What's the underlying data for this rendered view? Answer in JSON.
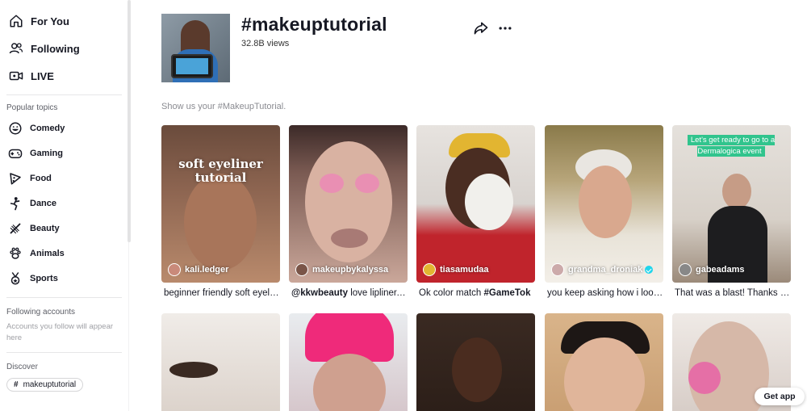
{
  "sidebar": {
    "nav": [
      {
        "label": "For You",
        "icon": "home-icon"
      },
      {
        "label": "Following",
        "icon": "following-icon"
      },
      {
        "label": "LIVE",
        "icon": "live-icon"
      }
    ],
    "popular_title": "Popular topics",
    "topics": [
      {
        "label": "Comedy",
        "icon": "comedy-icon"
      },
      {
        "label": "Gaming",
        "icon": "gaming-icon"
      },
      {
        "label": "Food",
        "icon": "food-icon"
      },
      {
        "label": "Dance",
        "icon": "dance-icon"
      },
      {
        "label": "Beauty",
        "icon": "beauty-icon"
      },
      {
        "label": "Animals",
        "icon": "animals-icon"
      },
      {
        "label": "Sports",
        "icon": "sports-icon"
      }
    ],
    "following_title": "Following accounts",
    "following_empty": "Accounts you follow will appear here",
    "discover_title": "Discover",
    "discover_tag": "makeuptutorial"
  },
  "header": {
    "title": "#makeuptutorial",
    "views": "32.8B views",
    "description": "Show us your #MakeupTutorial."
  },
  "videos_row1": [
    {
      "user": "kali.ledger",
      "caption": "beginner friendly soft eyeliner tutorial",
      "overlay": "soft eyeliner tutorial",
      "verified": false
    },
    {
      "user": "makeupbykalyssa",
      "caption_bold": "@kkwbeauty",
      "caption": " love lipliner, lipstick",
      "verified": false
    },
    {
      "user": "tiasamudaa",
      "caption": "Ok color match ",
      "caption_bold": "#GameTok",
      "verified": false
    },
    {
      "user": "grandma_droniak",
      "caption": "you keep asking how i look so good",
      "verified": true
    },
    {
      "user": "gabeadams",
      "caption": "That was a blast! Thanks for having me",
      "overlay": "Let's get ready to go to a Dermalogica event",
      "verified": false
    }
  ],
  "get_app": "Get app",
  "colors": {
    "accent": "#fe2c55",
    "verified": "#20d5ec",
    "text": "#161823"
  }
}
